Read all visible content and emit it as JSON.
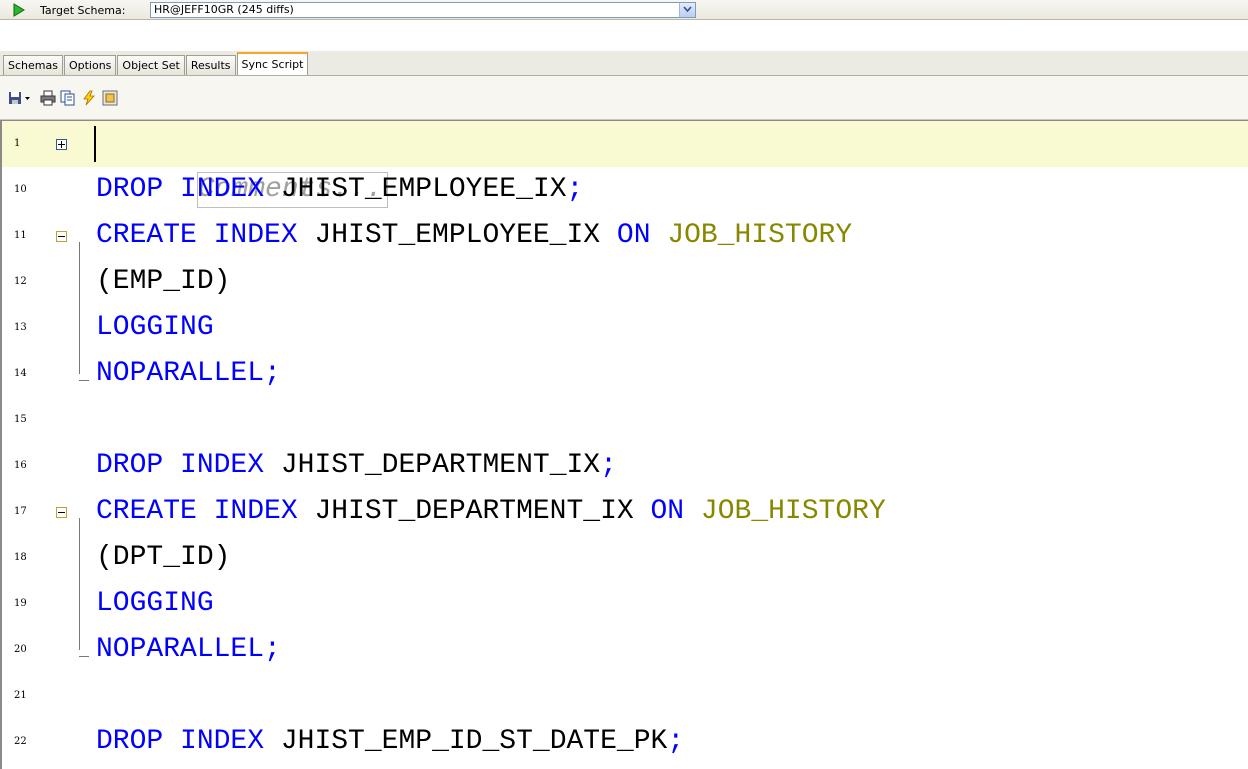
{
  "toolbar": {
    "target_label": "Target Schema:",
    "schema_value": "HR@JEFF10GR  (245 diffs)"
  },
  "tabs": [
    {
      "label": "Schemas"
    },
    {
      "label": "Options"
    },
    {
      "label": "Object Set"
    },
    {
      "label": "Results"
    },
    {
      "label": "Sync Script",
      "active": true
    }
  ],
  "icons": [
    "save-dropdown-icon",
    "print-icon",
    "copy-script-icon",
    "execute-icon",
    "open-editor-icon"
  ],
  "editor": {
    "comment_placeholder": "Comments...",
    "lines": [
      {
        "num": "1"
      },
      {
        "num": "10",
        "k1": "DROP INDEX ",
        "n1": "JHIST_EMPLOYEE_IX",
        "sep": ";"
      },
      {
        "num": "11",
        "k1": "CREATE INDEX ",
        "n1": "JHIST_EMPLOYEE_IX ",
        "k2": "ON ",
        "o1": "JOB_HISTORY"
      },
      {
        "num": "12",
        "text": "(EMP_ID)"
      },
      {
        "num": "13",
        "k1": "LOGGING"
      },
      {
        "num": "14",
        "k1": "NOPARALLEL",
        "sep": ";"
      },
      {
        "num": "15"
      },
      {
        "num": "16",
        "k1": "DROP INDEX ",
        "n1": "JHIST_DEPARTMENT_IX",
        "sep": ";"
      },
      {
        "num": "17",
        "k1": "CREATE INDEX ",
        "n1": "JHIST_DEPARTMENT_IX ",
        "k2": "ON ",
        "o1": "JOB_HISTORY"
      },
      {
        "num": "18",
        "text": "(DPT_ID)"
      },
      {
        "num": "19",
        "k1": "LOGGING"
      },
      {
        "num": "20",
        "k1": "NOPARALLEL",
        "sep": ";"
      },
      {
        "num": "21"
      },
      {
        "num": "22",
        "k1": "DROP INDEX ",
        "n1": "JHIST_EMP_ID_ST_DATE_PK",
        "sep": ";"
      }
    ]
  },
  "colors": {
    "keyword": "#0000ff",
    "object": "#888800",
    "current_line": "#fafad2",
    "active_tab_accent": "#f9a62b"
  }
}
